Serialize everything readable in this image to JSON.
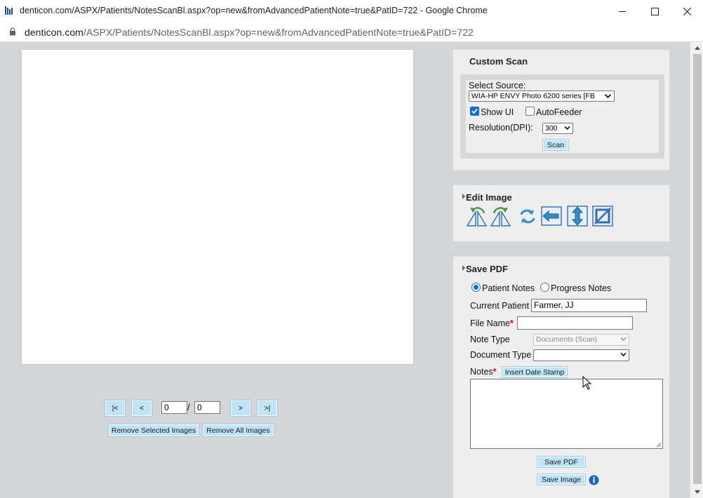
{
  "window": {
    "title": "denticon.com/ASPX/Patients/NotesScanBl.aspx?op=new&fromAdvancedPatientNote=true&PatID=722 - Google Chrome",
    "url_host": "denticon.com",
    "url_path": "/ASPX/Patients/NotesScanBl.aspx?op=new&fromAdvancedPatientNote=true&PatID=722"
  },
  "pager": {
    "first_label": "|<",
    "prev_label": "<",
    "current_page": "0",
    "separator": "/",
    "total_pages": "0",
    "next_label": ">",
    "last_label": ">|",
    "remove_selected_label": "Remove Selected Images",
    "remove_all_label": "Remove All Images"
  },
  "custom_scan": {
    "title": "Custom Scan",
    "source_label": "Select Source:",
    "source_value": "WIA-HP ENVY Photo 6200 series [FB",
    "show_ui_label": "Show UI",
    "show_ui_checked": true,
    "autofeeder_label": "AutoFeeder",
    "autofeeder_checked": false,
    "resolution_label": "Resolution(DPI):",
    "resolution_value": "300",
    "scan_label": "Scan"
  },
  "edit_image": {
    "title": "Edit Image",
    "tools": [
      "rotate-left-icon",
      "rotate-right-icon",
      "rotate-180-icon",
      "flip-horizontal-icon",
      "flip-vertical-icon",
      "crop-icon"
    ]
  },
  "save_pdf": {
    "title": "Save PDF",
    "patient_notes_label": "Patient Notes",
    "progress_notes_label": "Progress Notes",
    "selected_note_kind": "Patient Notes",
    "current_patient_label": "Current Patient",
    "current_patient_value": "Farmer, JJ",
    "file_name_label": "File Name",
    "required_mark": "*",
    "file_name_value": "",
    "note_type_label": "Note Type",
    "note_type_value": "Documents (Scan)",
    "document_type_label": "Document Type",
    "document_type_value": "",
    "notes_label": "Notes",
    "insert_date_stamp_label": "Insert Date Stamp",
    "notes_value": "",
    "save_pdf_label": "Save PDF",
    "save_image_label": "Save Image"
  },
  "colors": {
    "content_bg": "#d2d6d8",
    "panel_bg": "#eeeeee",
    "button_bg": "#bfe3f7",
    "icon_blue": "#2f6fb0",
    "checkbox_blue": "#0b6fd6"
  }
}
